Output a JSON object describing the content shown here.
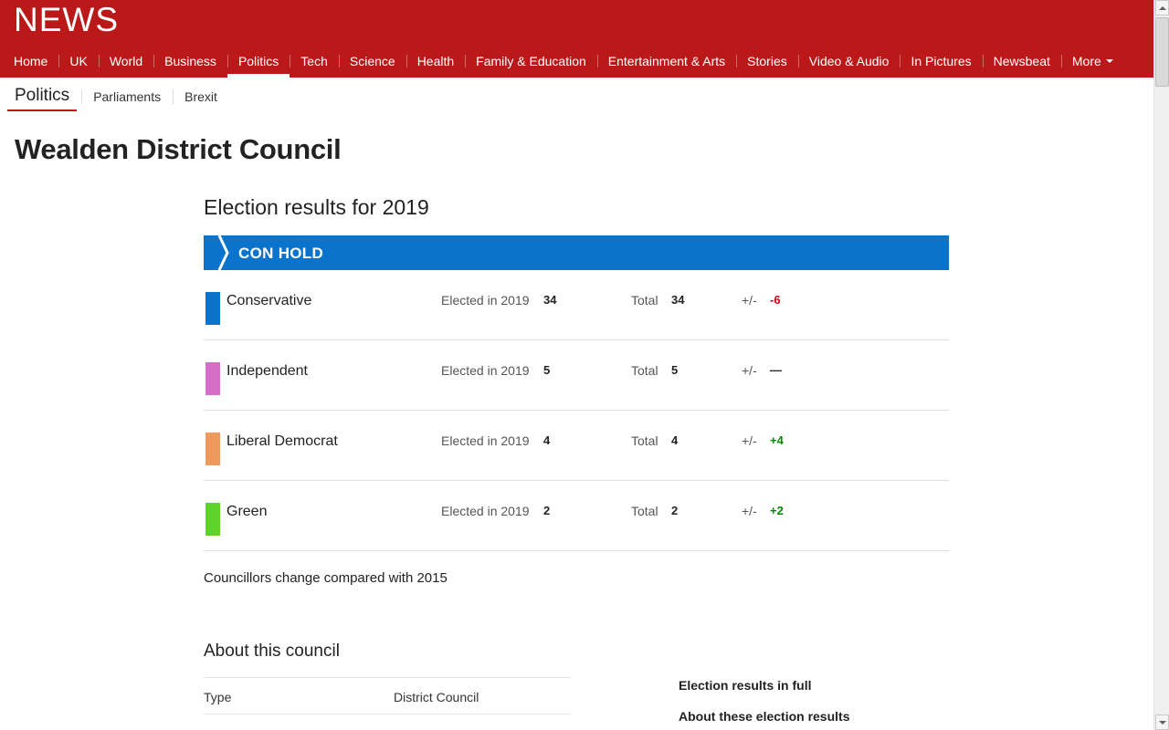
{
  "header": {
    "logo_text": "NEWS",
    "brand_color": "#bb1919",
    "nav": [
      {
        "label": "Home"
      },
      {
        "label": "UK"
      },
      {
        "label": "World"
      },
      {
        "label": "Business"
      },
      {
        "label": "Politics",
        "active": true
      },
      {
        "label": "Tech"
      },
      {
        "label": "Science"
      },
      {
        "label": "Health"
      },
      {
        "label": "Family & Education"
      },
      {
        "label": "Entertainment & Arts"
      },
      {
        "label": "Stories"
      },
      {
        "label": "Video & Audio"
      },
      {
        "label": "In Pictures"
      },
      {
        "label": "Newsbeat"
      },
      {
        "label": "More"
      }
    ]
  },
  "subnav": {
    "title": "Politics",
    "items": [
      "Parliaments",
      "Brexit"
    ]
  },
  "page": {
    "title": "Wealden District Council"
  },
  "results": {
    "heading": "Election results for 2019",
    "banner": "CON HOLD",
    "banner_color": "#0a74cd",
    "elected_label": "Elected in 2019",
    "total_label": "Total",
    "change_label": "+/-",
    "parties": [
      {
        "name": "Conservative",
        "color": "#0a74cd",
        "elected": "34",
        "total": "34",
        "change": "-6",
        "change_color": "#d0021b"
      },
      {
        "name": "Independent",
        "color": "#d36fc6",
        "elected": "5",
        "total": "5",
        "change": "—",
        "change_color": "#222222"
      },
      {
        "name": "Liberal Democrat",
        "color": "#ee9a5f",
        "elected": "4",
        "total": "4",
        "change": "+4",
        "change_color": "#008a00"
      },
      {
        "name": "Green",
        "color": "#5fd32a",
        "elected": "2",
        "total": "2",
        "change": "+2",
        "change_color": "#008a00"
      }
    ],
    "footnote": "Councillors change compared with 2015"
  },
  "about": {
    "heading": "About this council",
    "rows": [
      {
        "key": "Type",
        "value": "District Council"
      }
    ]
  },
  "side_links": [
    "Election results in full",
    "About these election results"
  ]
}
